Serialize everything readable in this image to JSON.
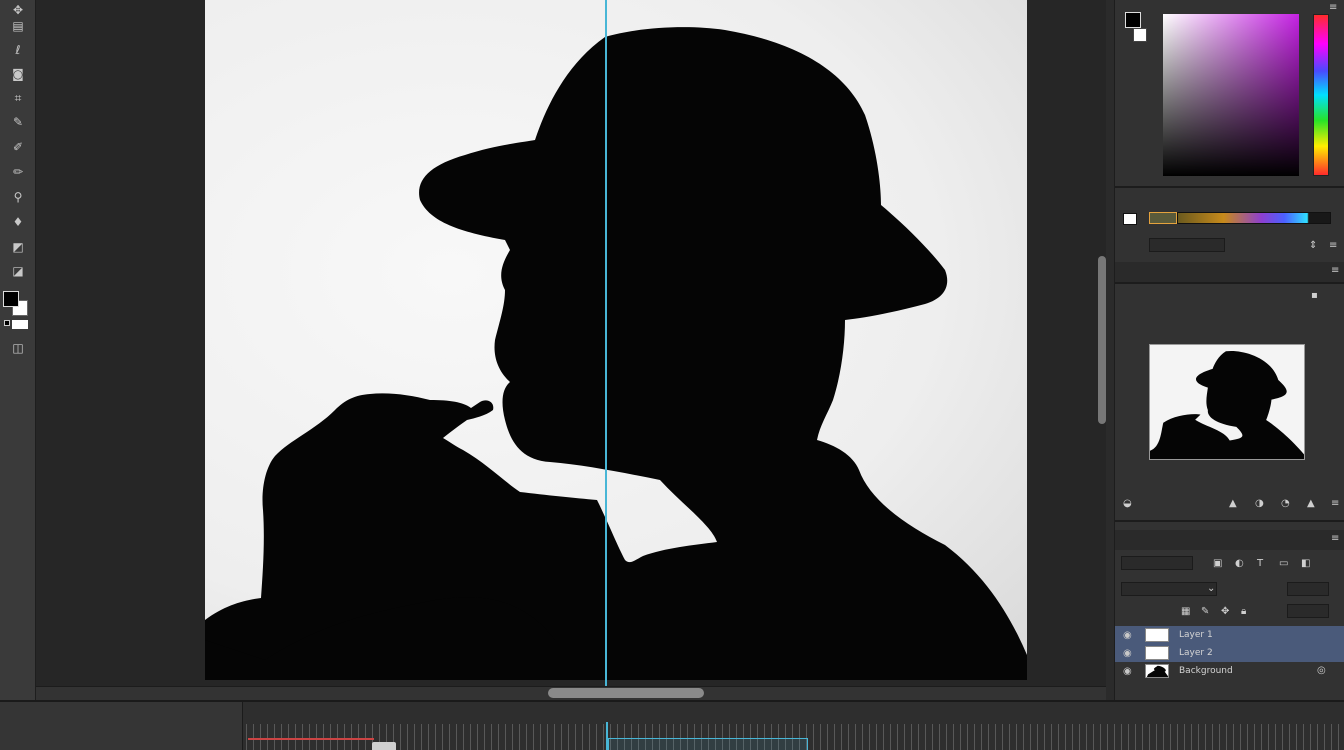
{
  "toolbar": {
    "tools": [
      {
        "name": "move-tool-icon",
        "glyph": "✥"
      },
      {
        "name": "marquee-tool-icon",
        "glyph": "▤"
      },
      {
        "name": "lasso-tool-icon",
        "glyph": "ℓ"
      },
      {
        "name": "quick-select-tool-icon",
        "glyph": "◙"
      },
      {
        "name": "crop-tool-icon",
        "glyph": "⌗"
      },
      {
        "name": "eyedropper-tool-icon",
        "glyph": "✎"
      },
      {
        "name": "healing-brush-tool-icon",
        "glyph": "✐"
      },
      {
        "name": "brush-tool-icon",
        "glyph": "✏"
      },
      {
        "name": "clone-stamp-tool-icon",
        "glyph": "⚲"
      },
      {
        "name": "history-brush-tool-icon",
        "glyph": "♦"
      },
      {
        "name": "eraser-tool-icon",
        "glyph": "◩"
      },
      {
        "name": "gradient-tool-icon",
        "glyph": "◪"
      }
    ]
  },
  "colors": {
    "foreground": "#000000",
    "background": "#ffffff",
    "guide": "#48b6d6",
    "panel_bg": "#323232",
    "selected_layer": "#4a5a7a"
  },
  "layers": {
    "rows": [
      {
        "name": "Layer 1",
        "selected": true
      },
      {
        "name": "Layer 2",
        "selected": true
      },
      {
        "name": "Background",
        "selected": false
      }
    ]
  }
}
